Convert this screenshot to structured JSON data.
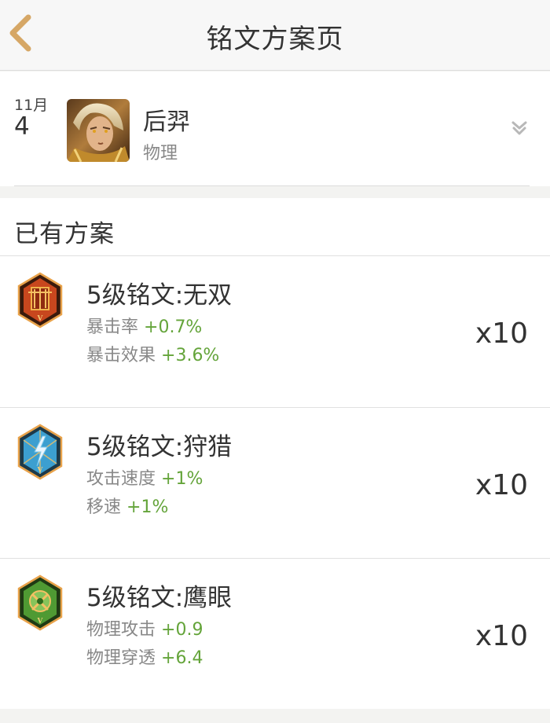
{
  "nav": {
    "title": "铭文方案页"
  },
  "hero": {
    "month": "11月",
    "day": "4",
    "name": "后羿",
    "type": "物理"
  },
  "section": {
    "title": "已有方案"
  },
  "runes": [
    {
      "name": "5级铭文:无双",
      "icon": "wushuang-rune-icon",
      "color": "#c8471e",
      "stats": [
        {
          "label": "暴击率",
          "value": "+0.7%"
        },
        {
          "label": "暴击效果",
          "value": "+3.6%"
        }
      ],
      "count": "x10"
    },
    {
      "name": "5级铭文:狩猎",
      "icon": "shoulie-rune-icon",
      "color": "#3c9fd0",
      "stats": [
        {
          "label": "攻击速度",
          "value": "+1%"
        },
        {
          "label": "移速",
          "value": "+1%"
        }
      ],
      "count": "x10"
    },
    {
      "name": "5级铭文:鹰眼",
      "icon": "yingyan-rune-icon",
      "color": "#4f9a33",
      "stats": [
        {
          "label": "物理攻击",
          "value": "+0.9"
        },
        {
          "label": "物理穿透",
          "value": "+6.4"
        }
      ],
      "count": "x10"
    }
  ],
  "colors": {
    "accent_green": "#64a43a",
    "back_arrow": "#d6a766"
  }
}
